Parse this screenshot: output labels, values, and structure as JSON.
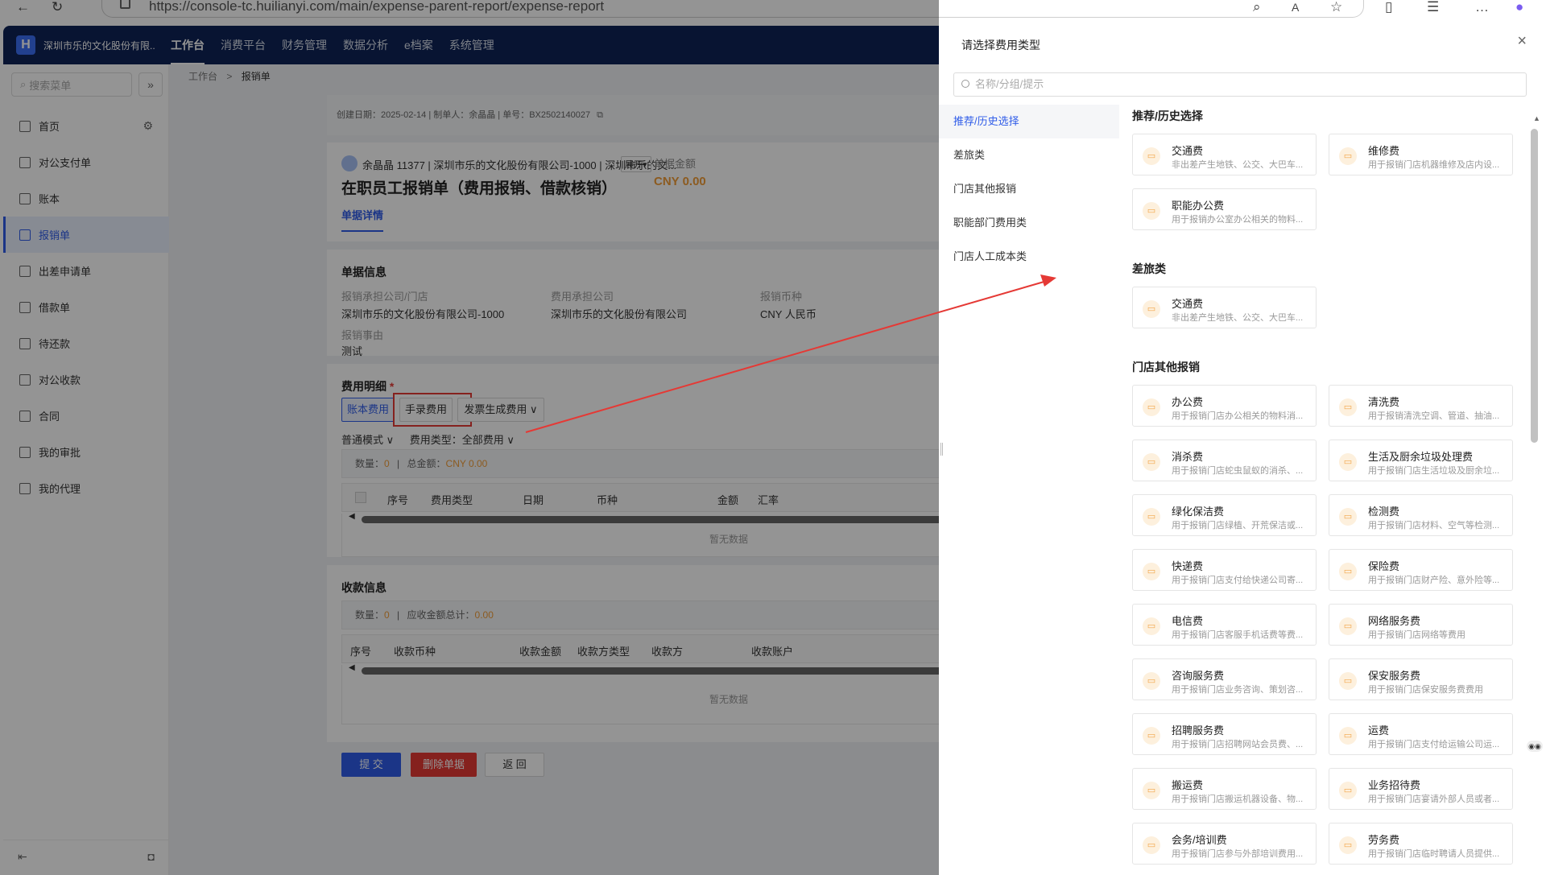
{
  "browser": {
    "url": "https://console-tc.huilianyi.com/main/expense-parent-report/expense-report"
  },
  "topnav": {
    "company": "深圳市乐的文化股份有限...",
    "items": [
      {
        "label": "工作台"
      },
      {
        "label": "消费平台"
      },
      {
        "label": "财务管理"
      },
      {
        "label": "数据分析"
      },
      {
        "label": "e档案"
      },
      {
        "label": "系统管理"
      }
    ]
  },
  "sidebar": {
    "search_placeholder": "搜索菜单",
    "items": [
      {
        "label": "首页"
      },
      {
        "label": "对公支付单"
      },
      {
        "label": "账本"
      },
      {
        "label": "报销单"
      },
      {
        "label": "出差申请单"
      },
      {
        "label": "借款单"
      },
      {
        "label": "待还款"
      },
      {
        "label": "对公收款"
      },
      {
        "label": "合同"
      },
      {
        "label": "我的审批"
      },
      {
        "label": "我的代理"
      }
    ]
  },
  "breadcrumb": {
    "home": "工作台",
    "sep": ">",
    "current": "报销单"
  },
  "meta": {
    "text": "创建日期：2025-02-14  |  制单人：余晶晶  |  单号：BX2502140027"
  },
  "header": {
    "person": "余晶晶 11377 | 深圳市乐的文化股份有限公司-1000 | 深圳市乐的文...",
    "expand": "展开▾",
    "amount_label": "单据金额",
    "amount": "CNY 0.00",
    "title": "在职员工报销单（费用报销、借款核销）",
    "tab": "单据详情"
  },
  "doc_info": {
    "title": "单据信息",
    "fields": [
      {
        "label": "报销承担公司/门店",
        "value": "深圳市乐的文化股份有限公司-1000"
      },
      {
        "label": "费用承担公司",
        "value": "深圳市乐的文化股份有限公司"
      },
      {
        "label": "报销币种",
        "value": "CNY 人民币"
      },
      {
        "label": "报销事由",
        "value": "测试"
      }
    ]
  },
  "expense": {
    "title": "费用明细",
    "required": "*",
    "buttons": [
      {
        "label": "账本费用"
      },
      {
        "label": "手录费用"
      },
      {
        "label": "发票生成费用 ∨"
      }
    ],
    "mode": "普通模式 ∨",
    "type_filter": "费用类型：全部费用 ∨",
    "summary_count_label": "数量：",
    "summary_count": "0",
    "summary_total_label": "总金额：",
    "summary_total": "CNY 0.00",
    "columns": [
      "序号",
      "费用类型",
      "日期",
      "币种",
      "金额",
      "汇率"
    ],
    "empty": "暂无数据"
  },
  "receipt": {
    "title": "收款信息",
    "count_label": "数量：",
    "count": "0",
    "total_label": "应收金额总计：",
    "total": "0.00",
    "columns": [
      "序号",
      "收款币种",
      "收款金额",
      "收款方类型",
      "收款方",
      "收款账户"
    ],
    "empty": "暂无数据"
  },
  "actions": {
    "submit": "提 交",
    "delete": "删除单据",
    "back": "返 回"
  },
  "drawer": {
    "title": "请选择费用类型",
    "close": "×",
    "search_placeholder": "名称/分组/提示",
    "categories": [
      {
        "label": "推荐/历史选择"
      },
      {
        "label": "差旅类"
      },
      {
        "label": "门店其他报销"
      },
      {
        "label": "职能部门费用类"
      },
      {
        "label": "门店人工成本类"
      }
    ],
    "groups": [
      {
        "title": "推荐/历史选择",
        "items": [
          {
            "name": "交通费",
            "desc": "非出差产生地铁、公交、大巴车..."
          },
          {
            "name": "维修费",
            "desc": "用于报销门店机器维修及店内设..."
          },
          {
            "name": "职能办公费",
            "desc": "用于报销办公室办公相关的物料..."
          }
        ]
      },
      {
        "title": "差旅类",
        "items": [
          {
            "name": "交通费",
            "desc": "非出差产生地铁、公交、大巴车..."
          }
        ]
      },
      {
        "title": "门店其他报销",
        "items": [
          {
            "name": "办公费",
            "desc": "用于报销门店办公相关的物料消..."
          },
          {
            "name": "清洗费",
            "desc": "用于报销清洗空调、管道、抽油..."
          },
          {
            "name": "消杀费",
            "desc": "用于报销门店蛇虫鼠蚁的消杀、..."
          },
          {
            "name": "生活及厨余垃圾处理费",
            "desc": "用于报销门店生活垃圾及厨余垃..."
          },
          {
            "name": "绿化保洁费",
            "desc": "用于报销门店绿植、开荒保洁或..."
          },
          {
            "name": "检测费",
            "desc": "用于报销门店材料、空气等检测..."
          },
          {
            "name": "快递费",
            "desc": "用于报销门店支付给快递公司寄..."
          },
          {
            "name": "保险费",
            "desc": "用于报销门店财产险、意外险等..."
          },
          {
            "name": "电信费",
            "desc": "用于报销门店客服手机话费等费..."
          },
          {
            "name": "网络服务费",
            "desc": "用于报销门店网络等费用"
          },
          {
            "name": "咨询服务费",
            "desc": "用于报销门店业务咨询、策划咨..."
          },
          {
            "name": "保安服务费",
            "desc": "用于报销门店保安服务费费用"
          },
          {
            "name": "招聘服务费",
            "desc": "用于报销门店招聘网站会员费、..."
          },
          {
            "name": "运费",
            "desc": "用于报销门店支付给运输公司运..."
          },
          {
            "name": "搬运费",
            "desc": "用于报销门店搬运机器设备、物..."
          },
          {
            "name": "业务招待费",
            "desc": "用于报销门店宴请外部人员或者..."
          },
          {
            "name": "会务/培训费",
            "desc": "用于报销门店参与外部培训费用..."
          },
          {
            "name": "劳务费",
            "desc": "用于报销门店临时聘请人员提供..."
          }
        ]
      }
    ]
  },
  "colors": {
    "nav": "#0f2457",
    "accent": "#2f5ce8",
    "amount": "#f29d38",
    "danger": "#e53935",
    "arrow": "#e53935"
  }
}
